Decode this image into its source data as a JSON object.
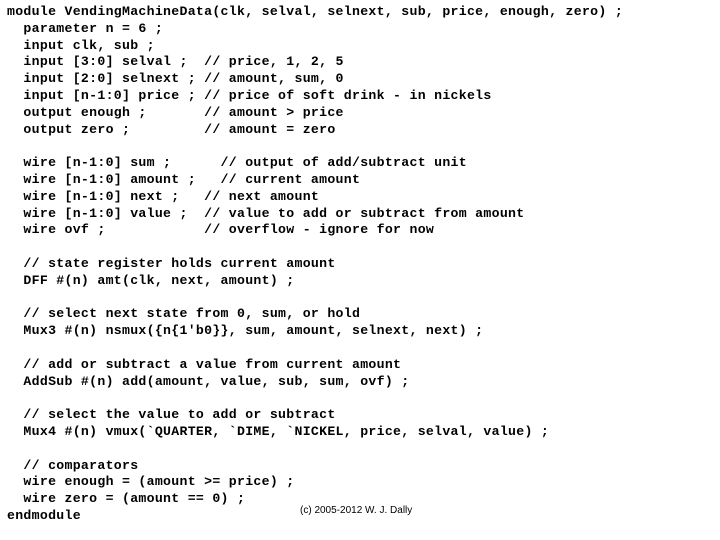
{
  "document": {
    "language": "verilog",
    "lines": [
      "module VendingMachineData(clk, selval, selnext, sub, price, enough, zero) ;",
      "  parameter n = 6 ;",
      "  input clk, sub ;",
      "  input [3:0] selval ;  // price, 1, 2, 5",
      "  input [2:0] selnext ; // amount, sum, 0",
      "  input [n-1:0] price ; // price of soft drink - in nickels",
      "  output enough ;       // amount > price",
      "  output zero ;         // amount = zero",
      "",
      "  wire [n-1:0] sum ;      // output of add/subtract unit",
      "  wire [n-1:0] amount ;   // current amount",
      "  wire [n-1:0] next ;   // next amount",
      "  wire [n-1:0] value ;  // value to add or subtract from amount",
      "  wire ovf ;            // overflow - ignore for now",
      "",
      "  // state register holds current amount",
      "  DFF #(n) amt(clk, next, amount) ;",
      "",
      "  // select next state from 0, sum, or hold",
      "  Mux3 #(n) nsmux({n{1'b0}}, sum, amount, selnext, next) ;",
      "",
      "  // add or subtract a value from current amount",
      "  AddSub #(n) add(amount, value, sub, sum, ovf) ;",
      "",
      "  // select the value to add or subtract",
      "  Mux4 #(n) vmux(`QUARTER, `DIME, `NICKEL, price, selval, value) ;",
      "",
      "  // comparators",
      "  wire enough = (amount >= price) ;",
      "  wire zero = (amount == 0) ;",
      "endmodule"
    ],
    "copyright": "(c) 2005-2012 W. J. Dally"
  }
}
